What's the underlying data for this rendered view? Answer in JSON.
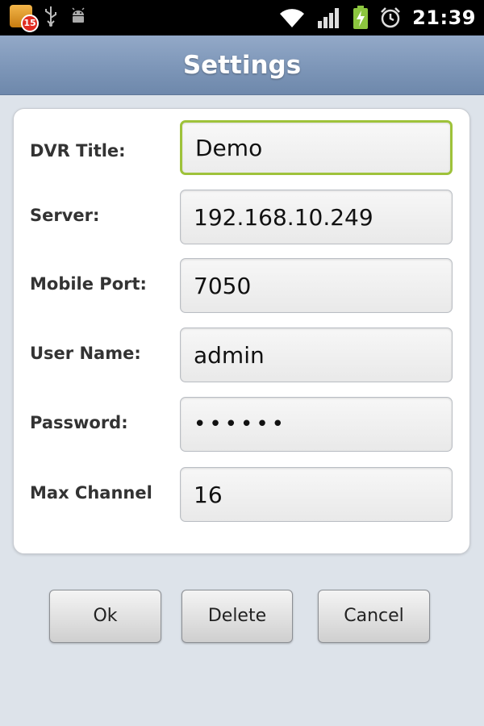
{
  "status_bar": {
    "notification_badge": "15",
    "time": "21:39",
    "icons": [
      "calendar-icon",
      "usb-icon",
      "android-debug-icon",
      "wifi-icon",
      "signal-icon",
      "battery-charging-icon",
      "alarm-icon"
    ]
  },
  "header": {
    "title": "Settings"
  },
  "form": {
    "dvr_title": {
      "label": "DVR Title:",
      "value": "Demo"
    },
    "server": {
      "label": "Server:",
      "value": "192.168.10.249"
    },
    "mobile_port": {
      "label": "Mobile Port:",
      "value": "7050"
    },
    "user_name": {
      "label": "User Name:",
      "value": "admin"
    },
    "password": {
      "label": "Password:",
      "value": "••••••"
    },
    "max_channel": {
      "label": "Max Channel",
      "value": "16"
    }
  },
  "buttons": {
    "ok": "Ok",
    "delete": "Delete",
    "cancel": "Cancel"
  },
  "colors": {
    "title_bar": "#7d96b8",
    "focus_border": "#9ec23a",
    "background": "#dde3ea"
  }
}
